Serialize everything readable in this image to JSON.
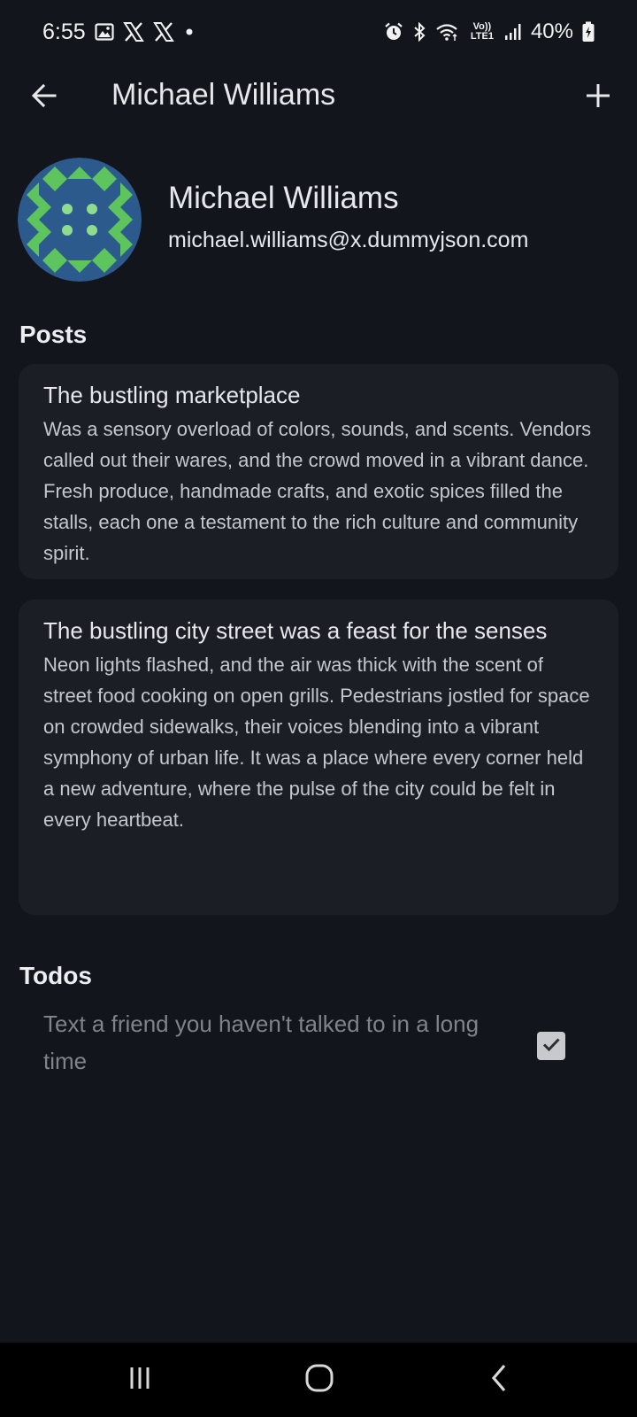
{
  "status_bar": {
    "time": "6:55",
    "network_label": "Vo)) LTE1",
    "battery": "40%",
    "icons": [
      "gallery-icon",
      "x-logo-icon",
      "x-logo-icon",
      "dot-icon",
      "alarm-icon",
      "bluetooth-icon",
      "wifi-icon",
      "lte-icon",
      "signal-icon",
      "battery-charging-icon"
    ]
  },
  "app_bar": {
    "title": "Michael Williams",
    "back_icon": "arrow-left-icon",
    "add_icon": "plus-icon"
  },
  "profile": {
    "name": "Michael Williams",
    "email": "michael.williams@x.dummyjson.com",
    "avatar_colors": {
      "background": "#2d5a8c",
      "accent": "#5ec45e",
      "dots": "#8fdc8f"
    }
  },
  "posts": {
    "section_title": "Posts",
    "items": [
      {
        "title": "The bustling marketplace",
        "body": "Was a sensory overload of colors, sounds, and scents. Vendors called out their wares, and the crowd moved in a vibrant dance. Fresh produce, handmade crafts, and exotic spices filled the stalls, each one a testament to the rich culture and community spirit."
      },
      {
        "title": "The bustling city street was a feast for the senses",
        "body": "Neon lights flashed, and the air was thick with the scent of street food cooking on open grills. Pedestrians jostled for space on crowded sidewalks, their voices blending into a vibrant symphony of urban life. It was a place where every corner held a new adventure, where the pulse of the city could be felt in every heartbeat."
      }
    ]
  },
  "todos": {
    "section_title": "Todos",
    "items": [
      {
        "text": "Text a friend you haven't talked to in a long time",
        "completed": true
      }
    ]
  },
  "nav_bar": {
    "icons": [
      "recent-apps-icon",
      "home-icon",
      "back-icon"
    ]
  },
  "colors": {
    "background": "#12151b",
    "card": "#1b1e24",
    "text_primary": "#e6e8ec",
    "text_secondary": "#c4c7cc",
    "text_muted": "#7f848b"
  }
}
